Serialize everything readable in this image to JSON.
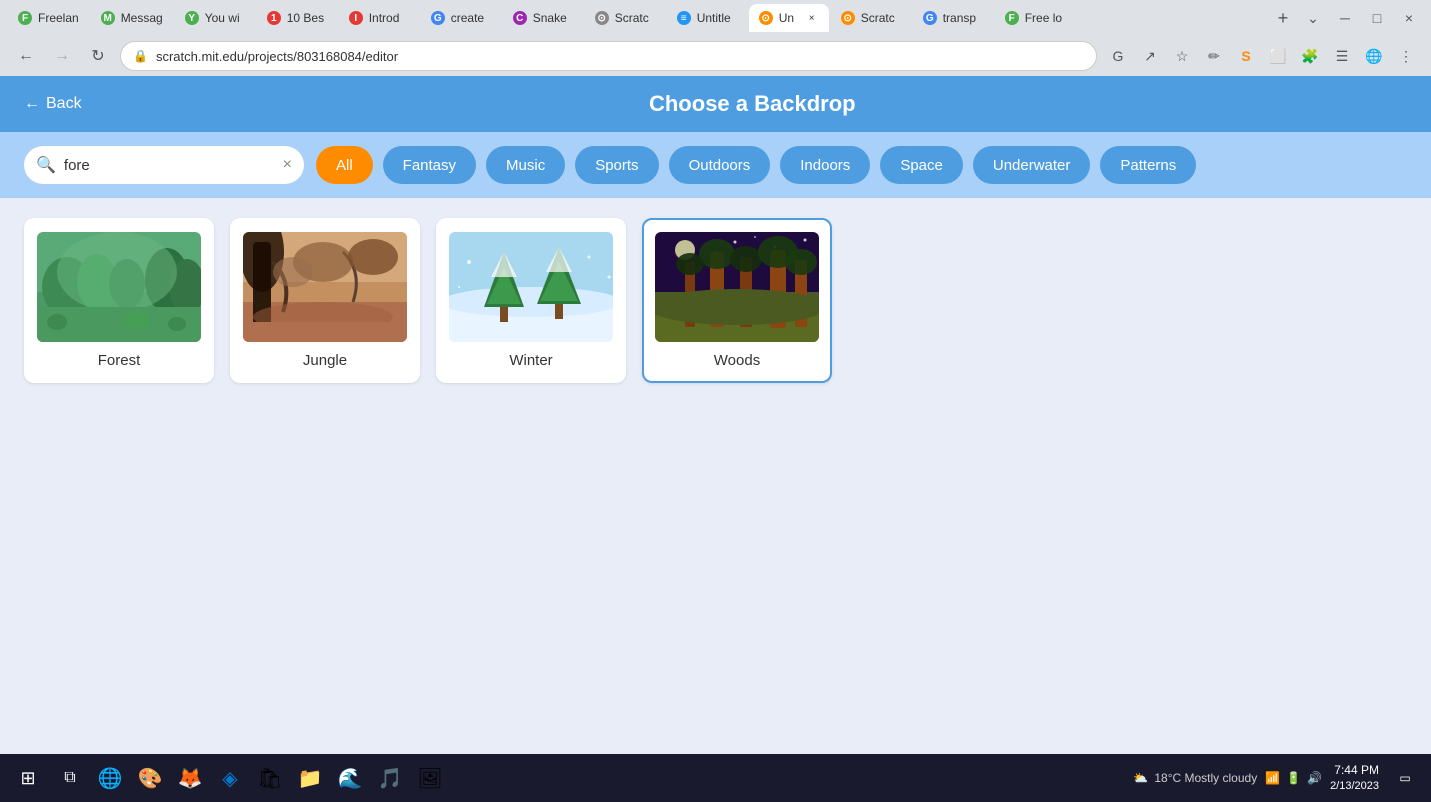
{
  "browser": {
    "url": "scratch.mit.edu/projects/803168084/editor",
    "tabs": [
      {
        "id": "freelan",
        "label": "Freelan",
        "favicon_color": "#4caf50",
        "favicon_text": "F",
        "active": false
      },
      {
        "id": "messag",
        "label": "Messag",
        "favicon_color": "#4caf50",
        "favicon_text": "M",
        "active": false
      },
      {
        "id": "youwi",
        "label": "You wi",
        "favicon_color": "#4caf50",
        "favicon_text": "Y",
        "active": false
      },
      {
        "id": "10bes",
        "label": "10 Bes",
        "favicon_color": "#e53935",
        "favicon_text": "1",
        "active": false
      },
      {
        "id": "introd",
        "label": "Introd",
        "favicon_color": "#e53935",
        "favicon_text": "I",
        "active": false
      },
      {
        "id": "create",
        "label": "create",
        "favicon_color": "#4285f4",
        "favicon_text": "G",
        "active": false
      },
      {
        "id": "snake",
        "label": "Snake",
        "favicon_color": "#9c27b0",
        "favicon_text": "C",
        "active": false
      },
      {
        "id": "scratch1",
        "label": "Scratc",
        "favicon_color": "#888",
        "favicon_text": "⊙",
        "active": false
      },
      {
        "id": "untitle",
        "label": "Untitle",
        "favicon_color": "#2196f3",
        "favicon_text": "≡",
        "active": false
      },
      {
        "id": "current",
        "label": "Un",
        "favicon_color": "#ff8c00",
        "favicon_text": "⊙",
        "active": true
      },
      {
        "id": "scratch2",
        "label": "Scratc",
        "favicon_color": "#ff8c00",
        "favicon_text": "⊙",
        "active": false
      },
      {
        "id": "transp",
        "label": "transp",
        "favicon_color": "#4285f4",
        "favicon_text": "G",
        "active": false
      },
      {
        "id": "freelo2",
        "label": "Free lo",
        "favicon_color": "#4caf50",
        "favicon_text": "F",
        "active": false
      }
    ],
    "nav": {
      "back_disabled": false,
      "forward_disabled": false
    }
  },
  "page": {
    "header": {
      "back_label": "Back",
      "title": "Choose a Backdrop"
    },
    "search": {
      "value": "fore",
      "placeholder": "Search"
    },
    "filters": [
      {
        "id": "all",
        "label": "All",
        "active": true
      },
      {
        "id": "fantasy",
        "label": "Fantasy",
        "active": false
      },
      {
        "id": "music",
        "label": "Music",
        "active": false
      },
      {
        "id": "sports",
        "label": "Sports",
        "active": false
      },
      {
        "id": "outdoors",
        "label": "Outdoors",
        "active": false
      },
      {
        "id": "indoors",
        "label": "Indoors",
        "active": false
      },
      {
        "id": "space",
        "label": "Space",
        "active": false
      },
      {
        "id": "underwater",
        "label": "Underwater",
        "active": false
      },
      {
        "id": "patterns",
        "label": "Patterns",
        "active": false
      }
    ],
    "backdrops": [
      {
        "id": "forest",
        "label": "Forest",
        "selected": false,
        "scene": "forest"
      },
      {
        "id": "jungle",
        "label": "Jungle",
        "selected": false,
        "scene": "jungle"
      },
      {
        "id": "winter",
        "label": "Winter",
        "selected": false,
        "scene": "winter"
      },
      {
        "id": "woods",
        "label": "Woods",
        "selected": true,
        "scene": "woods"
      }
    ]
  },
  "taskbar": {
    "time": "7:44 PM",
    "date": "2/13/2023",
    "weather": "18°C  Mostly cloudy"
  },
  "icons": {
    "search": "🔍",
    "back_arrow": "←",
    "close": "×",
    "windows_start": "⊞",
    "chevron_down": "⌄"
  }
}
